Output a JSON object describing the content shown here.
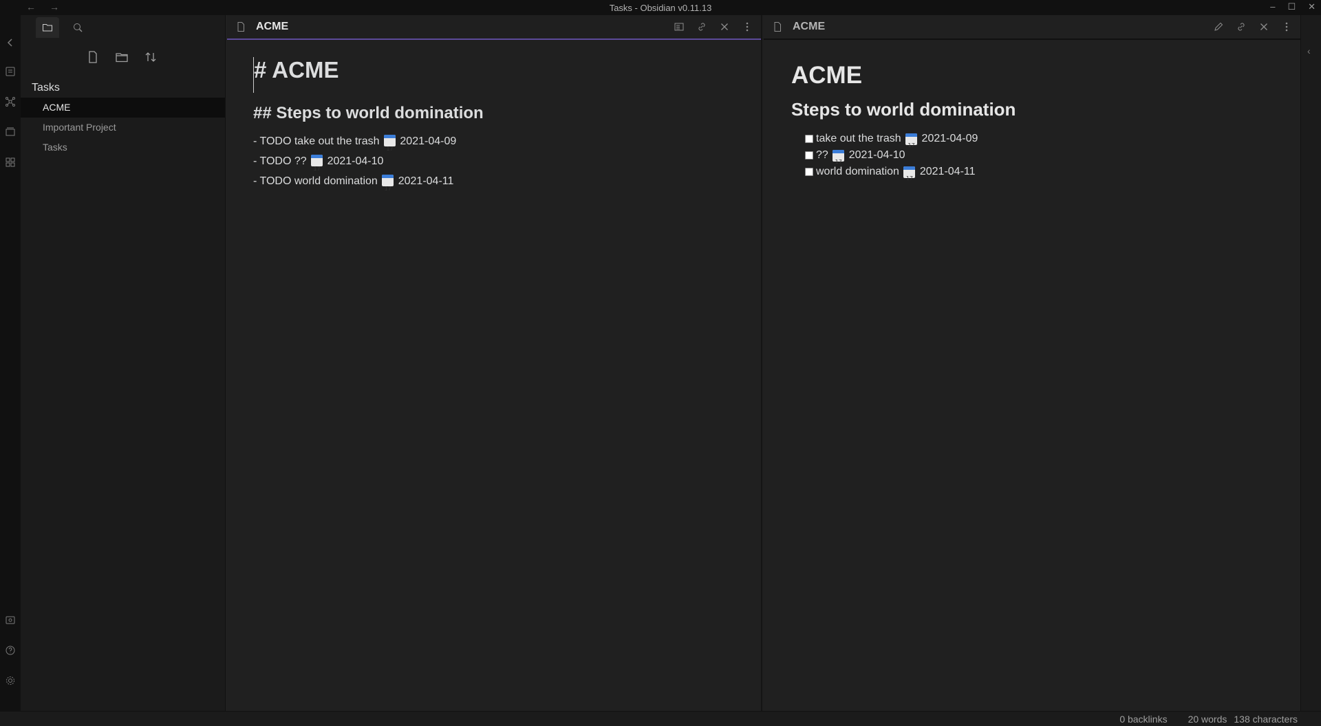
{
  "window": {
    "title": "Tasks - Obsidian v0.11.13"
  },
  "sidebar": {
    "vault_name": "Tasks",
    "files": [
      {
        "label": "ACME"
      },
      {
        "label": "Important Project"
      },
      {
        "label": "Tasks"
      }
    ]
  },
  "editor": {
    "tab_title": "ACME",
    "lines": {
      "h1": "# ACME",
      "h2": "## Steps to world domination",
      "task1_text": "- TODO take out the trash",
      "task1_date": "2021-04-09",
      "task2_text": "- TODO ??",
      "task2_date": "2021-04-10",
      "task3_text": "- TODO world domination",
      "task3_date": "2021-04-11"
    }
  },
  "preview": {
    "tab_title": "ACME",
    "h1": "ACME",
    "h2": "Steps to world domination",
    "tasks": [
      {
        "text": "take out the trash",
        "date": "2021-04-09",
        "checked": false
      },
      {
        "text": "??",
        "date": "2021-04-10",
        "checked": false
      },
      {
        "text": "world domination",
        "date": "2021-04-11",
        "checked": false
      }
    ]
  },
  "statusbar": {
    "backlinks": "0 backlinks",
    "words": "20 words",
    "characters": "138 characters"
  },
  "colors": {
    "accent": "#5c4a9a",
    "background": "#202020",
    "sidebar": "#1b1b1b"
  }
}
